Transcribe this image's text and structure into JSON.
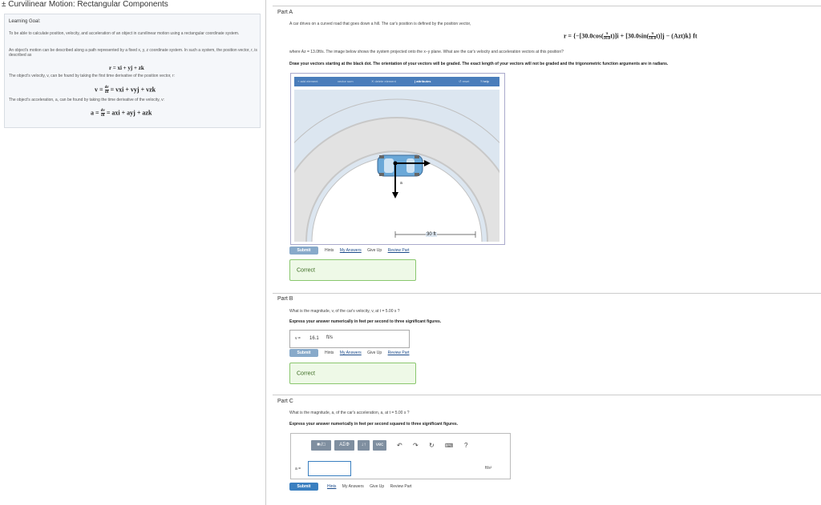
{
  "title": "± Curvilinear Motion: Rectangular Components",
  "learning_goal": {
    "heading": "Learning Goal:",
    "p1": "To be able to calculate position, velocity, and acceleration of an object in curvilinear motion using a rectangular coordinate system.",
    "p2": "An object's motion can be described along a path represented by a fixed x, y, z coordinate system. In such a system, the position vector, r, is described as",
    "eq_r": "r = xi + yj + zk",
    "p3": "The object's velocity, v, can be found by taking the first time derivative of the position vector, r:",
    "eq_v_lhs": "v =",
    "eq_v_num": "dr",
    "eq_v_den": "dt",
    "eq_v_rhs": "= vxi + vyj + vzk",
    "p4": "The object's acceleration, a, can be found by taking the time derivative of the velocity, v:",
    "eq_a_lhs": "a =",
    "eq_a_num": "dv",
    "eq_a_den": "dt",
    "eq_a_rhs": "= axi + ayj + azk"
  },
  "part_a": {
    "heading": "Part A",
    "intro": "A car drives on a curved road that goes down a hill. The car's position is defined by the position vector,",
    "eq_prefix": "r = {−[30.0cos(",
    "eq_frac_num": "π",
    "eq_frac_den": "10.0",
    "eq_mid": "t)]i + [30.0sin(",
    "eq_frac2_num": "π",
    "eq_frac2_den": "10.0",
    "eq_suffix": "t)]j − (Azt)k} ft",
    "where": "where Az = 13.0ft/s. The image below shows the system projected onto the x−y plane. What are the car's velocity and acceleration vectors at this position?",
    "instruction": "Draw your vectors starting at the black dot. The orientation of your vectors will be graded. The exact length of your vectors will not be graded and the trigonometric function arguments are in radians.",
    "toolbar": {
      "add": "+ add element",
      "sum": "vector sum",
      "delete": "✕ delete element",
      "attributes": "| attributes",
      "reset": "↺ reset",
      "help": "? help"
    },
    "scale_label": "30 ft",
    "vector_label": "a",
    "submit": "Submit",
    "hints": "Hints",
    "my_answers": "My Answers",
    "give_up": "Give Up",
    "review": "Review Part",
    "status": "Correct"
  },
  "part_b": {
    "heading": "Part B",
    "question": "What is the magnitude, v, of the car's velocity, v, at t = 5.00 s ?",
    "instruction": "Express your answer numerically in feet per second to three significant figures.",
    "answer_label": "v =",
    "answer_value": "16.1",
    "answer_unit": "ft/s",
    "submit": "Submit",
    "hints": "Hints",
    "my_answers": "My Answers",
    "give_up": "Give Up",
    "review": "Review Part",
    "status": "Correct"
  },
  "part_c": {
    "heading": "Part C",
    "question": "What is the magnitude, a, of the car's acceleration, a, at t = 5.00 s ?",
    "instruction": "Express your answer numerically in feet per second squared to three significant figures.",
    "editor_buttons": [
      "■√□",
      "ΑΣΦ",
      "↓↑",
      "vec"
    ],
    "answer_label": "a =",
    "answer_value": "",
    "answer_unit": "ft/s²",
    "submit": "Submit",
    "hints": "Hints",
    "my_answers": "My Answers",
    "give_up": "Give Up",
    "review": "Review Part"
  },
  "colors": {
    "accent": "#3a7fc0",
    "correct_bg": "#eef9e7",
    "correct_border": "#8ac76e",
    "car": "#6aa8d8"
  }
}
